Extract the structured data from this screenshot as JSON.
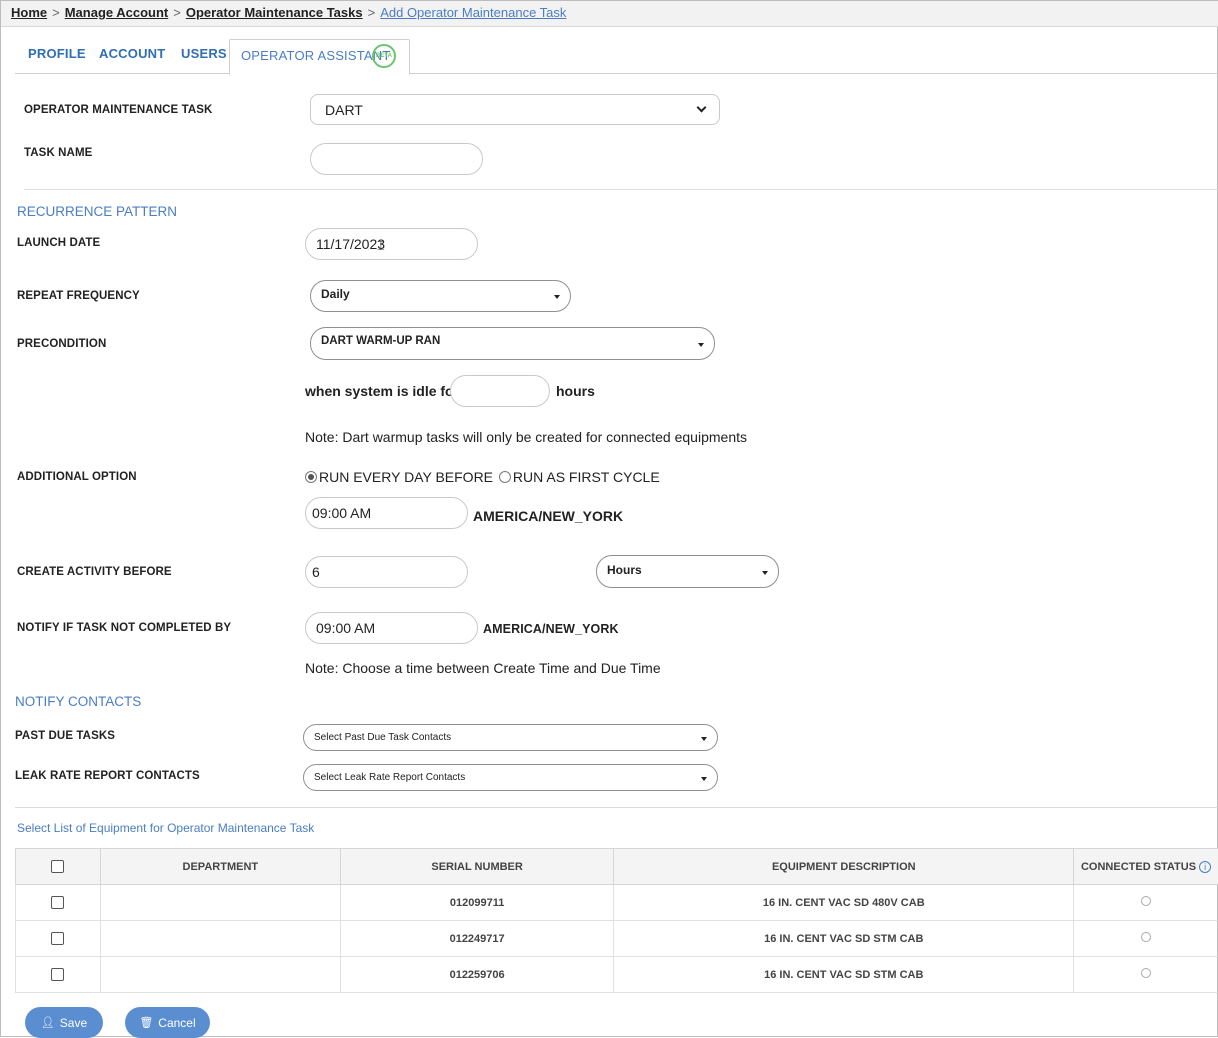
{
  "breadcrumb": {
    "home": "Home",
    "manage_account": "Manage Account",
    "tasks": "Operator Maintenance Tasks",
    "current": "Add Operator Maintenance Task",
    "sep": ">"
  },
  "tabs": {
    "profile": "PROFILE",
    "account": "ACCOUNT",
    "users": "USERS",
    "operator_assistant": "OPERATOR ASSISTANT",
    "beta": "BETA"
  },
  "form": {
    "task_label": "OPERATOR MAINTENANCE TASK",
    "task_value": "DART",
    "task_name_label": "TASK NAME",
    "task_name_value": "",
    "recurrence_title": "RECURRENCE PATTERN",
    "launch_date_label": "LAUNCH DATE",
    "launch_date_value": "11/17/2023",
    "repeat_label": "REPEAT FREQUENCY",
    "repeat_value": "Daily",
    "precondition_label": "PRECONDITION",
    "precondition_value": "DART WARM-UP RAN",
    "idle_prefix": "when system is idle for",
    "idle_value": "",
    "idle_suffix": "hours",
    "note_dart": "Note: Dart warmup tasks will only be created for connected equipments",
    "additional_label": "ADDITIONAL OPTION",
    "option_before": "RUN EVERY DAY BEFORE",
    "option_first": "RUN AS FIRST CYCLE",
    "option_time": "09:00 AM",
    "timezone_1": "AMERICA/NEW_YORK",
    "create_label": "CREATE ACTIVITY BEFORE",
    "create_value": "6",
    "create_unit": "Hours",
    "notify_label": "NOTIFY IF TASK NOT COMPLETED BY",
    "notify_time": "09:00 AM",
    "timezone_2": "AMERICA/NEW_YORK",
    "note_time": "Note: Choose a time between Create Time and Due Time"
  },
  "contacts": {
    "title": "NOTIFY CONTACTS",
    "past_due_label": "PAST DUE TASKS",
    "past_due_placeholder": "Select Past Due Task Contacts",
    "leak_label": "LEAK RATE REPORT CONTACTS",
    "leak_placeholder": "Select Leak Rate Report Contacts"
  },
  "equipment": {
    "title": "Select List of Equipment for Operator Maintenance Task",
    "columns": [
      "DEPARTMENT",
      "SERIAL NUMBER",
      "EQUIPMENT DESCRIPTION",
      "CONNECTED STATUS"
    ],
    "info": "i",
    "rows": [
      {
        "department": "",
        "serial": "012099711",
        "description": "16 IN. CENT VAC SD 480V CAB"
      },
      {
        "department": "",
        "serial": "012249717",
        "description": "16 IN. CENT VAC SD STM CAB"
      },
      {
        "department": "",
        "serial": "012259706",
        "description": "16 IN. CENT VAC SD STM CAB"
      }
    ]
  },
  "buttons": {
    "save": "Save",
    "cancel": "Cancel"
  },
  "colors": {
    "accent": "#4a7dc4",
    "button": "#5b8ed1",
    "beta": "#6cc46c"
  }
}
